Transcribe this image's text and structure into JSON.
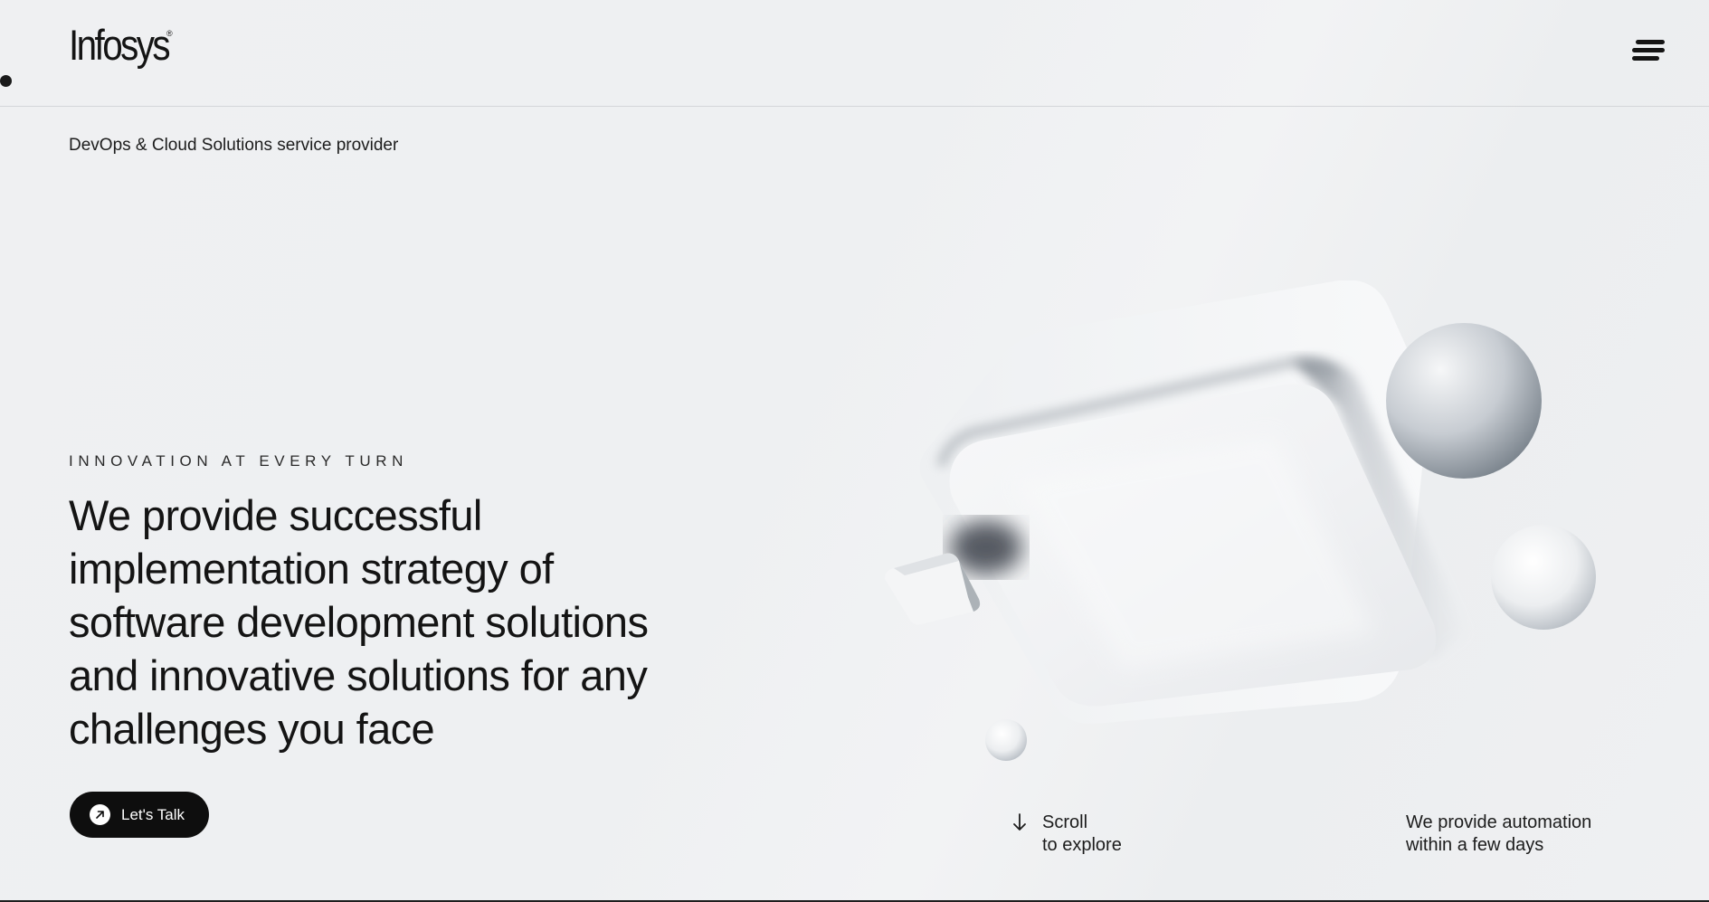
{
  "header": {
    "logo_text": "Infosys",
    "logo_mark": "®",
    "menu_icon": "hamburger-menu-icon"
  },
  "hero": {
    "tagline": "DevOps & Cloud Solutions service provider",
    "eyebrow": "INNOVATION AT EVERY TURN",
    "headline": "We provide successful implementation strategy of software development solutions and innovative solutions for any challenges you face",
    "cta_label": "Let's Talk",
    "cta_icon": "arrow-up-right-icon"
  },
  "scroll_hint": {
    "icon": "arrow-down-icon",
    "line1": "Scroll",
    "line2": "to explore"
  },
  "automation_note": {
    "line1": "We provide automation",
    "line2": "within a few days"
  },
  "colors": {
    "background": "#eff0f2",
    "text": "#141414",
    "cta_background": "#0e0e0e"
  }
}
